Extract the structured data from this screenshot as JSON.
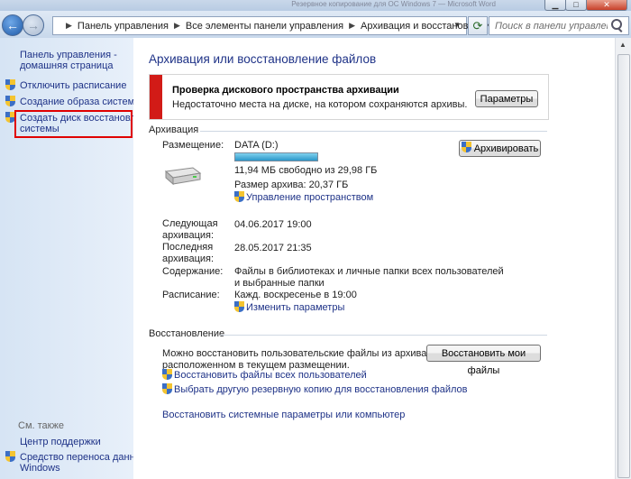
{
  "window": {
    "title": "Резервное копирование для ОС Windows 7 — Microsoft Word"
  },
  "address_bar": {
    "crumbs": [
      "Панель управления",
      "Все элементы панели управления",
      "Архивация и восстановление"
    ]
  },
  "search": {
    "placeholder": "Поиск в панели управления"
  },
  "sidebar": {
    "home_link": "Панель управления -\nдомашняя страница",
    "items": [
      {
        "label": "Отключить расписание",
        "icon": "shield-icon"
      },
      {
        "label": "Создание образа системы",
        "icon": "shield-icon"
      },
      {
        "label": "Создать диск восстановления\nсистемы",
        "icon": "shield-icon"
      }
    ],
    "see_also_title": "См. также",
    "see_also": [
      {
        "label": "Центр поддержки"
      },
      {
        "label": "Средство переноса данных\nWindows",
        "icon": "shield-icon"
      }
    ]
  },
  "main": {
    "title": "Архивация или восстановление файлов",
    "warning": {
      "title": "Проверка дискового пространства архивации",
      "text": "Недостаточно места на диске, на котором сохраняются архивы.",
      "button": "Параметры",
      "color": "#d21b17"
    },
    "backup": {
      "section_title": "Архивация",
      "location_label": "Размещение:",
      "location_value": "DATA (D:)",
      "backup_button": "Архивировать",
      "free_space": "11,94 МБ свободно из 29,98 ГБ",
      "used_fraction": 0.9996,
      "archive_size": "Размер архива: 20,37 ГБ",
      "manage_space_link": "Управление пространством",
      "next_label": "Следующая\nархивация:",
      "next_value": "04.06.2017 19:00",
      "last_label": "Последняя\nархивация:",
      "last_value": "28.05.2017 21:35",
      "contents_label": "Содержание:",
      "contents_value": "Файлы в библиотеках и личные папки всех пользователей\nи выбранные папки",
      "schedule_label": "Расписание:",
      "schedule_value": "Кажд. воскресенье в 19:00",
      "change_settings_link": "Изменить параметры"
    },
    "restore": {
      "section_title": "Восстановление",
      "text": "Можно восстановить пользовательские файлы из архива,\nрасположенном в текущем размещении.",
      "restore_button": "Восстановить мои файлы",
      "links": [
        {
          "label": "Восстановить файлы всех пользователей",
          "icon": "shield-icon"
        },
        {
          "label": "Выбрать другую резервную копию для восстановления файлов",
          "icon": "shield-icon"
        }
      ],
      "system_link": "Восстановить системные параметры или компьютер"
    }
  }
}
